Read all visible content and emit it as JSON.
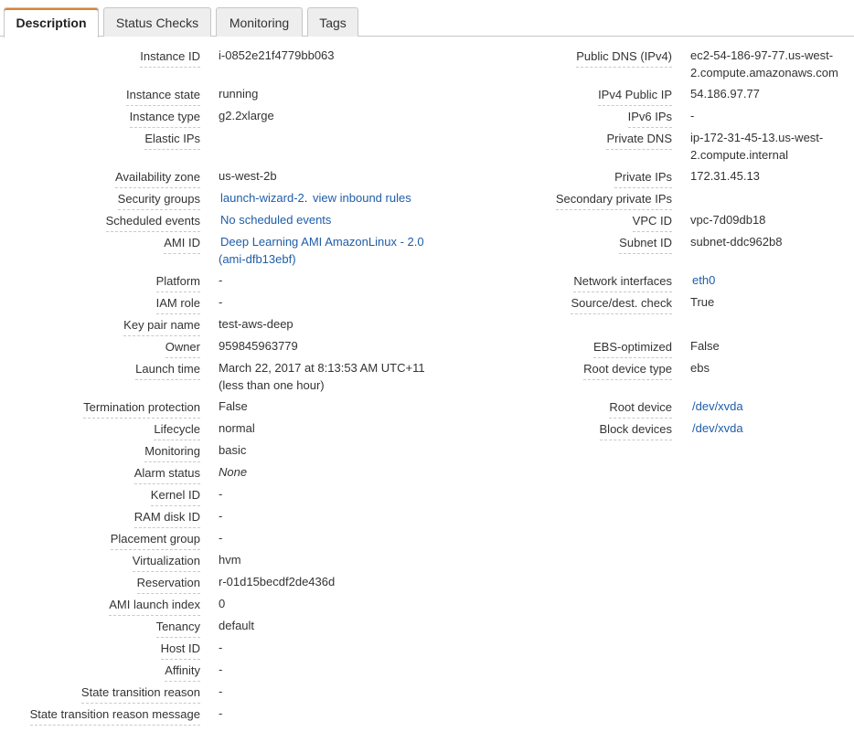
{
  "tabs": [
    {
      "label": "Description",
      "active": true
    },
    {
      "label": "Status Checks"
    },
    {
      "label": "Monitoring"
    },
    {
      "label": "Tags"
    }
  ],
  "colors": {
    "accent": "#e0812e",
    "link": "#1f5da8",
    "text": "#333333",
    "border": "#c6c6c6"
  },
  "left": {
    "instance_id": {
      "label": "Instance ID",
      "value": "i-0852e21f4779bb063"
    },
    "instance_state": {
      "label": "Instance state",
      "value": "running"
    },
    "instance_type": {
      "label": "Instance type",
      "value": "g2.2xlarge"
    },
    "elastic_ips": {
      "label": "Elastic IPs",
      "value": ""
    },
    "availability_zone": {
      "label": "Availability zone",
      "value": "us-west-2b"
    },
    "security_groups": {
      "label": "Security groups",
      "link1": "launch-wizard-2",
      "sep": ".",
      "link2": "view inbound rules"
    },
    "scheduled_events": {
      "label": "Scheduled events",
      "value": "No scheduled events"
    },
    "ami_id": {
      "label": "AMI ID",
      "value_line1": "Deep Learning AMI AmazonLinux - 2.0",
      "value_line2": "(ami-dfb13ebf)"
    },
    "platform": {
      "label": "Platform",
      "value": "-"
    },
    "iam_role": {
      "label": "IAM role",
      "value": "-"
    },
    "key_pair_name": {
      "label": "Key pair name",
      "value": "test-aws-deep"
    },
    "owner": {
      "label": "Owner",
      "value": "959845963779"
    },
    "launch_time": {
      "label": "Launch time",
      "value_line1": "March 22, 2017 at 8:13:53 AM UTC+11",
      "value_line2": "(less than one hour)"
    },
    "termination_protection": {
      "label": "Termination protection",
      "value": "False"
    },
    "lifecycle": {
      "label": "Lifecycle",
      "value": "normal"
    },
    "monitoring": {
      "label": "Monitoring",
      "value": "basic"
    },
    "alarm_status": {
      "label": "Alarm status",
      "value": "None"
    },
    "kernel_id": {
      "label": "Kernel ID",
      "value": "-"
    },
    "ram_disk_id": {
      "label": "RAM disk ID",
      "value": "-"
    },
    "placement_group": {
      "label": "Placement group",
      "value": "-"
    },
    "virtualization": {
      "label": "Virtualization",
      "value": "hvm"
    },
    "reservation": {
      "label": "Reservation",
      "value": "r-01d15becdf2de436d"
    },
    "ami_launch_index": {
      "label": "AMI launch index",
      "value": "0"
    },
    "tenancy": {
      "label": "Tenancy",
      "value": "default"
    },
    "host_id": {
      "label": "Host ID",
      "value": "-"
    },
    "affinity": {
      "label": "Affinity",
      "value": "-"
    },
    "state_transition_reason": {
      "label": "State transition reason",
      "value": "-"
    },
    "state_transition_reason_message": {
      "label": "State transition reason message",
      "value": "-"
    }
  },
  "right": {
    "public_dns": {
      "label": "Public DNS (IPv4)",
      "value_line1": "ec2-54-186-97-77.us-west-",
      "value_line2": "2.compute.amazonaws.com"
    },
    "ipv4_public_ip": {
      "label": "IPv4 Public IP",
      "value": "54.186.97.77"
    },
    "ipv6_ips": {
      "label": "IPv6 IPs",
      "value": "-"
    },
    "private_dns": {
      "label": "Private DNS",
      "value_line1": "ip-172-31-45-13.us-west-",
      "value_line2": "2.compute.internal"
    },
    "private_ips": {
      "label": "Private IPs",
      "value": "172.31.45.13"
    },
    "secondary_private_ips": {
      "label": "Secondary private IPs",
      "value": ""
    },
    "vpc_id": {
      "label": "VPC ID",
      "value": "vpc-7d09db18"
    },
    "subnet_id": {
      "label": "Subnet ID",
      "value": "subnet-ddc962b8"
    },
    "network_interfaces": {
      "label": "Network interfaces",
      "value": "eth0"
    },
    "source_dest_check": {
      "label": "Source/dest. check",
      "value": "True"
    },
    "ebs_optimized": {
      "label": "EBS-optimized",
      "value": "False"
    },
    "root_device_type": {
      "label": "Root device type",
      "value": "ebs"
    },
    "root_device": {
      "label": "Root device",
      "value": "/dev/xvda"
    },
    "block_devices": {
      "label": "Block devices",
      "value": "/dev/xvda"
    }
  }
}
